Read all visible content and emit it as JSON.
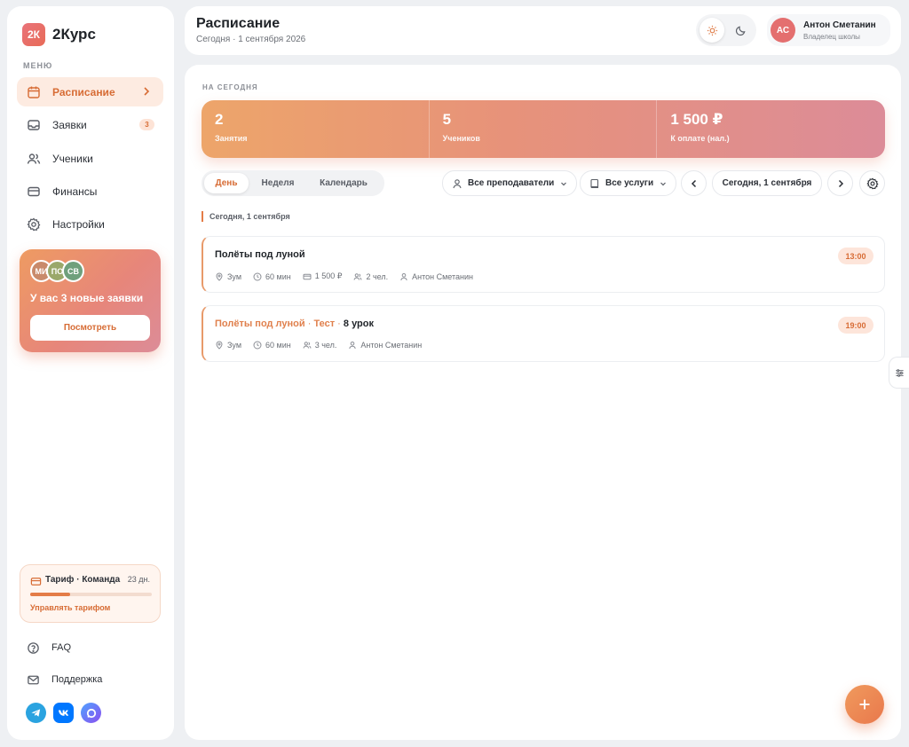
{
  "brand": {
    "logo_text": "2К",
    "name": "2Курс"
  },
  "sidebar": {
    "menu_label": "МЕНЮ",
    "items": [
      {
        "label": "Расписание",
        "icon": "calendar-icon",
        "active": true
      },
      {
        "label": "Заявки",
        "icon": "inbox-icon",
        "badge": "3"
      },
      {
        "label": "Ученики",
        "icon": "users-icon"
      },
      {
        "label": "Финансы",
        "icon": "wallet-icon"
      },
      {
        "label": "Настройки",
        "icon": "gear-icon"
      }
    ],
    "promo": {
      "avatars": [
        {
          "initials": "МИ",
          "color": "#c98a6b"
        },
        {
          "initials": "ПО",
          "color": "#9aa86a"
        },
        {
          "initials": "СВ",
          "color": "#6fa07c"
        }
      ],
      "text": "У вас 3 новые заявки",
      "button": "Посмотреть"
    },
    "tariff": {
      "title": "Тариф · Команда",
      "days": "23 дн.",
      "progress": 0.33,
      "link": "Управлять тарифом"
    },
    "footer": [
      {
        "label": "FAQ",
        "icon": "help-circle-icon"
      },
      {
        "label": "Поддержка",
        "icon": "mail-icon"
      }
    ],
    "socials": [
      {
        "name": "telegram-icon",
        "color": "#2aa3e0"
      },
      {
        "name": "vk-icon",
        "color": "#0077ff"
      },
      {
        "name": "max-messenger-icon",
        "color": "#7b5cf0"
      }
    ]
  },
  "header": {
    "title": "Расписание",
    "subtitle": "Сегодня · 1 сентября 2026",
    "user": {
      "initials": "АС",
      "name": "Антон Сметанин",
      "role": "Владелец школы"
    }
  },
  "main": {
    "section_label": "НА СЕГОДНЯ",
    "stats": [
      {
        "value": "2",
        "label": "Занятия"
      },
      {
        "value": "5",
        "label": "Учеников"
      },
      {
        "value": "1 500 ₽",
        "label": "К оплате (нал.)"
      }
    ],
    "views": [
      "День",
      "Неделя",
      "Календарь"
    ],
    "active_view": "День",
    "filters": {
      "teachers": "Все преподаватели",
      "services": "Все услуги",
      "date": "Сегодня, 1 сентября"
    },
    "date_heading": "Сегодня, 1 сентября",
    "lessons": [
      {
        "title": "Полёты под луной",
        "time": "13:00",
        "place": "Зум",
        "duration": "60 мин",
        "price": "1 500 ₽",
        "people": "2 чел.",
        "teacher": "Антон Сметанин"
      },
      {
        "title": "Полёты под луной",
        "tag": "Тест",
        "lesson_no": "8 урок",
        "time": "19:00",
        "place": "Зум",
        "duration": "60 мин",
        "people": "3 чел.",
        "teacher": "Антон Сметанин"
      }
    ]
  },
  "colors": {
    "accent": "#e47c47",
    "accent_dark": "#d76c35",
    "stats_from": "#eda56a",
    "stats_to": "#dc8c98"
  }
}
